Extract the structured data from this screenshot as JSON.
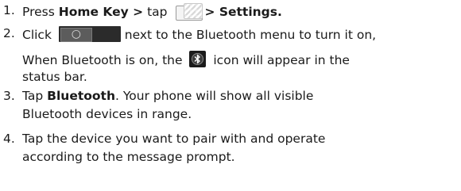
{
  "steps": [
    {
      "number": "1.",
      "text_before": "Press ",
      "bold_1": "Home Key >",
      "text_mid": " tap ",
      "icon": "app-launcher-icon",
      "bold_2": "> Settings."
    },
    {
      "number": "2.",
      "text_before": "Click ",
      "icon": "toggle-switch-icon",
      "text_after": " next to the Bluetooth menu to turn it on,",
      "line2_before": "When Bluetooth is on, the ",
      "icon2": "bluetooth-status-icon",
      "line2_after": " icon will appear in the",
      "line3": "status bar."
    },
    {
      "number": "3.",
      "text_before": "Tap ",
      "bold_1": "Bluetooth",
      "text_after": ". Your phone will show all visible",
      "line2": "Bluetooth devices in range."
    },
    {
      "number": "4.",
      "line1": "Tap the device you want to pair with and operate",
      "line2": "according to the message prompt."
    }
  ],
  "colors": {
    "text": "#1a1a1a",
    "toggle_bg": "#2b2b2b"
  }
}
